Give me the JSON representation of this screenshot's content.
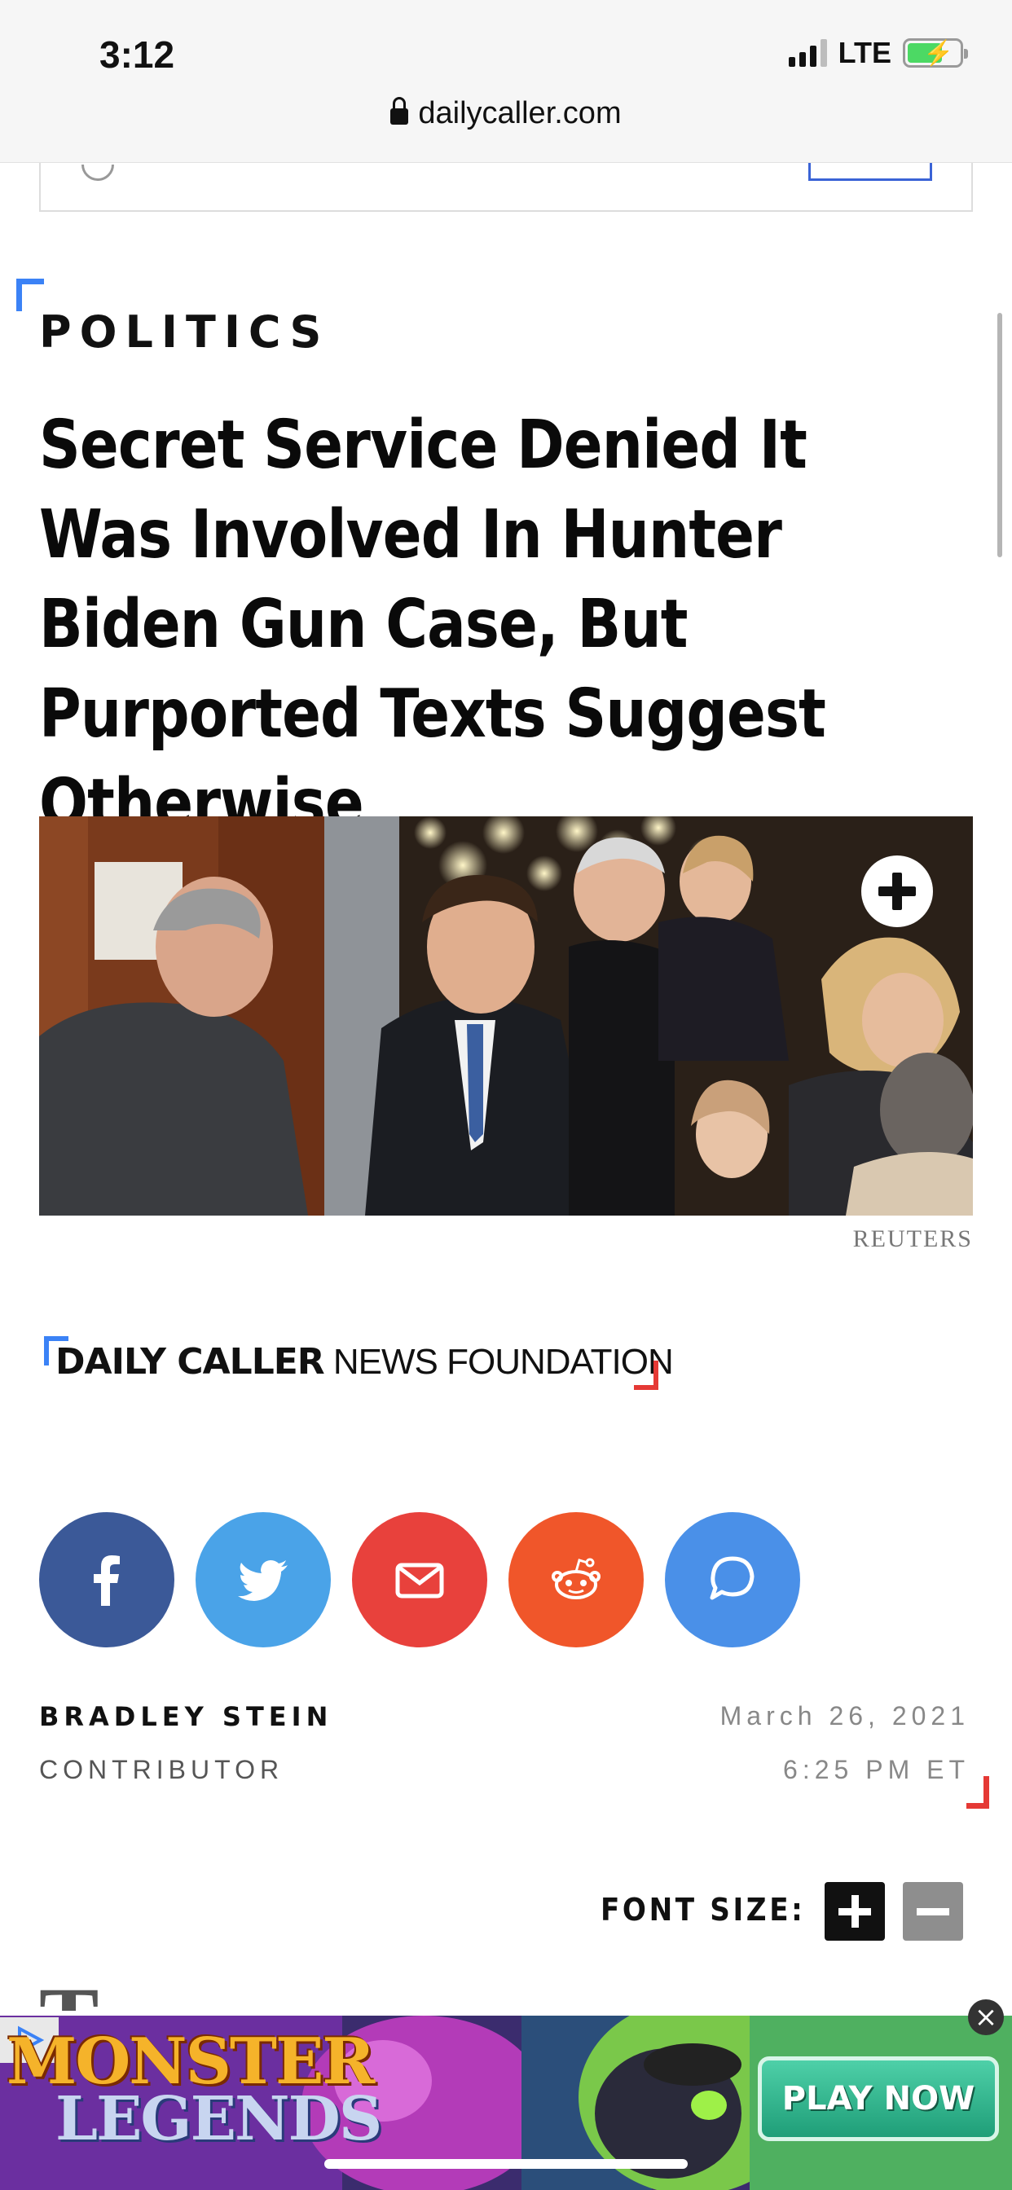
{
  "status_bar": {
    "time": "3:12",
    "network": "LTE",
    "battery_icon": "battery-charging-icon",
    "signal_icon": "cellular-signal-icon"
  },
  "browser": {
    "url": "dailycaller.com",
    "lock_icon": "lock-icon"
  },
  "article": {
    "category": "POLITICS",
    "headline": "Secret Service Denied It Was Involved In Hunter Biden Gun Case, But Purported Texts Suggest Otherwise",
    "image_credit": "REUTERS",
    "expand_icon": "plus-circle-icon"
  },
  "dcnf_logo": {
    "bold": "DAILY CALLER",
    "regular": "NEWS FOUNDATION"
  },
  "share": [
    {
      "name": "facebook",
      "icon": "facebook-icon",
      "color": "#3b5998"
    },
    {
      "name": "twitter",
      "icon": "twitter-icon",
      "color": "#4aa3e8"
    },
    {
      "name": "email",
      "icon": "mail-icon",
      "color": "#e8413c"
    },
    {
      "name": "reddit",
      "icon": "reddit-icon",
      "color": "#f0562a"
    },
    {
      "name": "comments",
      "icon": "chat-bubble-icon",
      "color": "#4a90e8"
    }
  ],
  "byline": {
    "author": "BRADLEY STEIN",
    "role": "CONTRIBUTOR",
    "date": "March 26, 2021",
    "time": "6:25 PM ET"
  },
  "font_size": {
    "label": "FONT SIZE:",
    "increase_icon": "plus-icon",
    "decrease_icon": "minus-icon"
  },
  "ad": {
    "title_line1": "MONSTER",
    "title_line2": "LEGENDS",
    "cta": "PLAY NOW",
    "close_icon": "close-icon",
    "adchoices_icon": "adchoices-icon"
  }
}
